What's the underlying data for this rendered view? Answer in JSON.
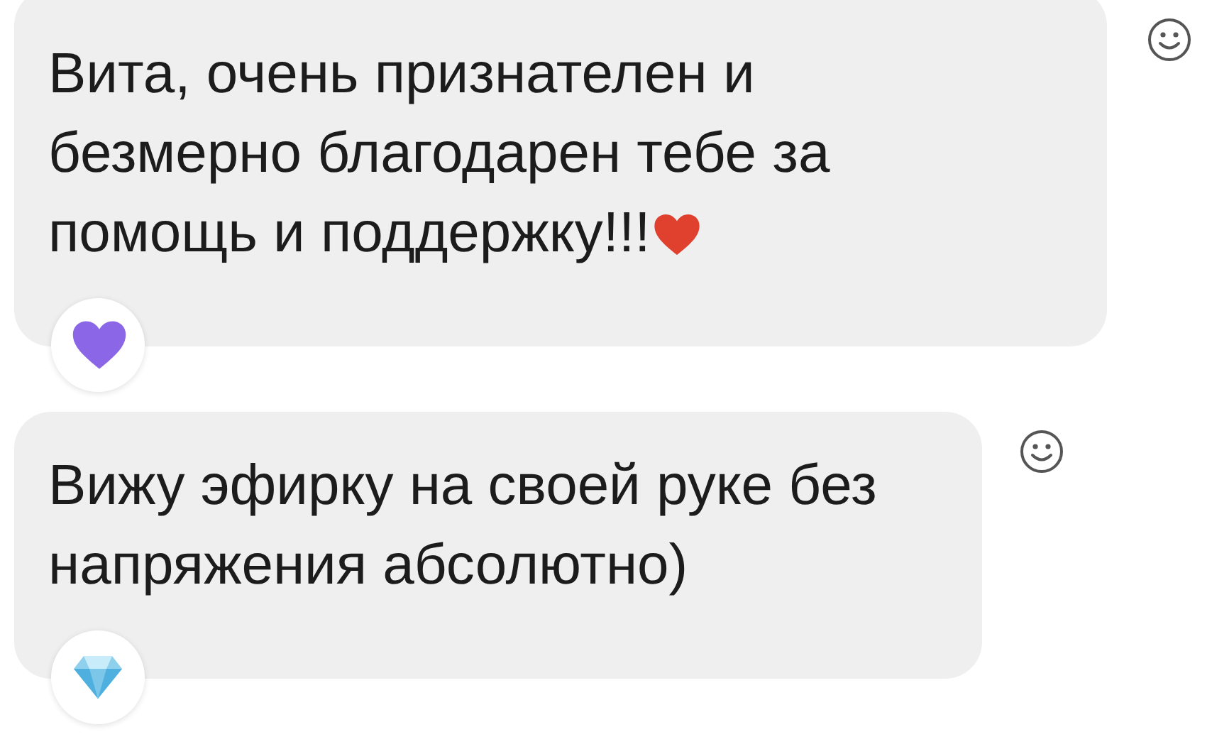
{
  "messages": [
    {
      "text": "Вита, очень признателен и\nбезмерно благодарен тебе за\nпомощь и поддержку!!!",
      "end_icon": {
        "kind": "heart"
      },
      "reaction": {
        "kind": "heart"
      }
    },
    {
      "text": "Вижу эфирку на своей руке без\nнапряжения абсолютно)",
      "reaction": {
        "kind": "gem"
      }
    }
  ]
}
